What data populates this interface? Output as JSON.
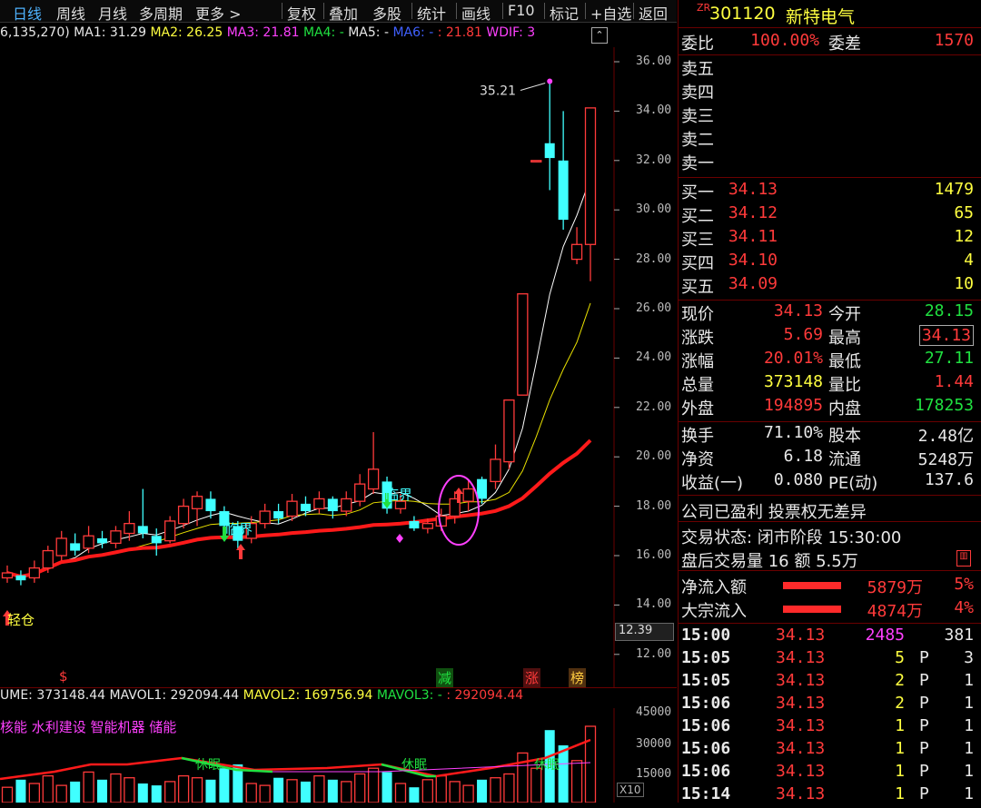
{
  "toolbar": {
    "items": [
      "日线",
      "周线",
      "月线",
      "多周期",
      "更多 >",
      "复权",
      "叠加",
      "多股",
      "统计",
      "画线",
      "F10",
      "标记",
      "+自选",
      "返回"
    ],
    "selected": "日线"
  },
  "ma_line": {
    "prefix": "6,135,270)",
    "ma1": "MA1: 31.29",
    "ma2": "MA2: 26.25",
    "ma3": "MA3: 21.81",
    "ma4": "MA4: -",
    "ma5": "MA5: -",
    "ma6": "MA6: -",
    "ma_last": ": 21.81",
    "wdif": "WDIF: 3"
  },
  "chart_data": {
    "type": "candlestick",
    "y_ticks": [
      "36.00",
      "34.00",
      "32.00",
      "30.00",
      "28.00",
      "26.00",
      "24.00",
      "22.00",
      "20.00",
      "18.00",
      "16.00",
      "14.00",
      "12.00"
    ],
    "ylim": [
      12,
      36.5
    ],
    "current_price_label": "12.39",
    "high_annotation": "35.21",
    "candles": [
      {
        "o": 15.1,
        "c": 15.3,
        "h": 15.6,
        "l": 14.9
      },
      {
        "o": 15.2,
        "c": 15.0,
        "h": 15.4,
        "l": 14.8
      },
      {
        "o": 15.1,
        "c": 15.5,
        "h": 15.8,
        "l": 14.9
      },
      {
        "o": 15.5,
        "c": 16.2,
        "h": 16.4,
        "l": 15.3
      },
      {
        "o": 16.0,
        "c": 16.7,
        "h": 17.0,
        "l": 15.8
      },
      {
        "o": 16.5,
        "c": 16.2,
        "h": 16.9,
        "l": 16.0
      },
      {
        "o": 16.3,
        "c": 16.8,
        "h": 17.2,
        "l": 16.1
      },
      {
        "o": 16.7,
        "c": 16.5,
        "h": 17.0,
        "l": 16.3
      },
      {
        "o": 16.5,
        "c": 17.0,
        "h": 17.2,
        "l": 16.3
      },
      {
        "o": 16.9,
        "c": 17.3,
        "h": 17.8,
        "l": 16.6
      },
      {
        "o": 17.2,
        "c": 16.9,
        "h": 18.7,
        "l": 16.7
      },
      {
        "o": 16.8,
        "c": 16.5,
        "h": 17.1,
        "l": 16.0
      },
      {
        "o": 16.6,
        "c": 17.4,
        "h": 17.6,
        "l": 16.5
      },
      {
        "o": 17.3,
        "c": 18.0,
        "h": 18.3,
        "l": 17.1
      },
      {
        "o": 17.9,
        "c": 18.4,
        "h": 18.6,
        "l": 17.2
      },
      {
        "o": 18.3,
        "c": 17.8,
        "h": 18.6,
        "l": 17.5
      },
      {
        "o": 17.8,
        "c": 17.2,
        "h": 18.0,
        "l": 17.0
      },
      {
        "o": 17.2,
        "c": 16.6,
        "h": 17.4,
        "l": 16.3
      },
      {
        "o": 16.7,
        "c": 17.3,
        "h": 17.6,
        "l": 16.5
      },
      {
        "o": 17.3,
        "c": 17.8,
        "h": 18.1,
        "l": 17.1
      },
      {
        "o": 17.8,
        "c": 17.5,
        "h": 18.1,
        "l": 17.3
      },
      {
        "o": 17.6,
        "c": 18.2,
        "h": 18.5,
        "l": 17.4
      },
      {
        "o": 18.1,
        "c": 17.8,
        "h": 18.4,
        "l": 17.6
      },
      {
        "o": 17.9,
        "c": 18.3,
        "h": 18.6,
        "l": 17.7
      },
      {
        "o": 18.3,
        "c": 17.8,
        "h": 18.4,
        "l": 17.5
      },
      {
        "o": 17.8,
        "c": 18.3,
        "h": 18.6,
        "l": 17.6
      },
      {
        "o": 18.2,
        "c": 18.9,
        "h": 19.3,
        "l": 18.0
      },
      {
        "o": 18.7,
        "c": 19.5,
        "h": 21.0,
        "l": 18.5
      },
      {
        "o": 19.0,
        "c": 17.9,
        "h": 19.2,
        "l": 17.7
      },
      {
        "o": 17.9,
        "c": 18.2,
        "h": 18.5,
        "l": 17.7
      },
      {
        "o": 17.4,
        "c": 17.1,
        "h": 17.6,
        "l": 17.0
      },
      {
        "o": 17.1,
        "c": 17.3,
        "h": 17.5,
        "l": 16.9
      },
      {
        "o": 17.2,
        "c": 17.6,
        "h": 17.9,
        "l": 17.0
      },
      {
        "o": 17.6,
        "c": 18.3,
        "h": 18.6,
        "l": 17.3
      },
      {
        "o": 18.2,
        "c": 18.7,
        "h": 19.1,
        "l": 17.8
      },
      {
        "o": 19.1,
        "c": 18.3,
        "h": 19.2,
        "l": 18.1
      },
      {
        "o": 19.0,
        "c": 19.9,
        "h": 20.5,
        "l": 18.7
      },
      {
        "o": 19.8,
        "c": 22.3,
        "h": 22.3,
        "l": 19.5
      },
      {
        "o": 22.5,
        "c": 26.6,
        "h": 26.6,
        "l": 22.5
      },
      {
        "o": 32.0,
        "c": 32.0,
        "h": 32.0,
        "l": 32.0
      },
      {
        "o": 32.7,
        "c": 32.1,
        "h": 35.21,
        "l": 30.8
      },
      {
        "o": 32.0,
        "c": 29.6,
        "h": 34.0,
        "l": 29.2
      },
      {
        "o": 28.0,
        "c": 28.6,
        "h": 29.3,
        "l": 27.8
      },
      {
        "o": 28.6,
        "c": 34.13,
        "h": 34.13,
        "l": 27.11
      }
    ],
    "signals": [
      {
        "label": "轻仓",
        "color": "#ffff40"
      },
      {
        "label": "临界",
        "color": "#40ffff"
      },
      {
        "label": "临界",
        "color": "#40ffff"
      }
    ],
    "bottom_markers": [
      {
        "label": "$",
        "color": "#ff3a3a"
      },
      {
        "label": "减",
        "color": "#20e040",
        "bg": "#105010"
      },
      {
        "label": "涨",
        "color": "#ff3a3a",
        "bg": "#501010"
      },
      {
        "label": "榜",
        "color": "#ffcc40",
        "bg": "#503010"
      }
    ]
  },
  "volume": {
    "line": {
      "volume": "UME: 373148.44",
      "mavol1": "MAVOL1: 292094.44",
      "mavol2": "MAVOL2: 169756.94",
      "mavol3": "MAVOL3: -",
      "mavol_last": ": 292094.44"
    },
    "concepts": "核能 水利建设 智能机器 储能",
    "y_ticks": [
      "45000",
      "30000",
      "15000"
    ],
    "x_label": "X10",
    "sleep_labels": [
      "休眠",
      "休眠",
      "休眠"
    ],
    "bars": [
      8,
      12,
      10,
      14,
      9,
      11,
      16,
      12,
      15,
      13,
      10,
      9,
      11,
      14,
      13,
      12,
      18,
      20,
      10,
      9,
      13,
      12,
      11,
      14,
      12,
      11,
      15,
      18,
      16,
      10,
      8,
      12,
      14,
      11,
      9,
      12,
      13,
      15,
      26,
      18,
      38,
      30,
      22,
      40
    ]
  },
  "quote": {
    "code": "301120",
    "name": "新特电气",
    "badge": "ZR",
    "weibi_label": "委比",
    "weibi": "100.00%",
    "weicha_label": "委差",
    "weicha": "1570",
    "sell": [
      {
        "label": "卖五"
      },
      {
        "label": "卖四"
      },
      {
        "label": "卖三"
      },
      {
        "label": "卖二"
      },
      {
        "label": "卖一"
      }
    ],
    "buy": [
      {
        "label": "买一",
        "price": "34.13",
        "vol": "1479"
      },
      {
        "label": "买二",
        "price": "34.12",
        "vol": "65"
      },
      {
        "label": "买三",
        "price": "34.11",
        "vol": "12"
      },
      {
        "label": "买四",
        "price": "34.10",
        "vol": "4"
      },
      {
        "label": "买五",
        "price": "34.09",
        "vol": "10"
      }
    ],
    "stats": [
      {
        "l": "现价",
        "lv": "34.13",
        "lc": "red",
        "r": "今开",
        "rv": "28.15",
        "rc": "green"
      },
      {
        "l": "涨跌",
        "lv": "5.69",
        "lc": "red",
        "r": "最高",
        "rv": "34.13",
        "rc": "red"
      },
      {
        "l": "涨幅",
        "lv": "20.01%",
        "lc": "red",
        "r": "最低",
        "rv": "27.11",
        "rc": "green"
      },
      {
        "l": "总量",
        "lv": "373148",
        "lc": "yellow",
        "r": "量比",
        "rv": "1.44",
        "rc": "red"
      },
      {
        "l": "外盘",
        "lv": "194895",
        "lc": "red",
        "r": "内盘",
        "rv": "178253",
        "rc": "green"
      }
    ],
    "stats2": [
      {
        "l": "换手",
        "lv": "71.10%",
        "r": "股本",
        "rv": "2.48亿"
      },
      {
        "l": "净资",
        "lv": "6.18",
        "r": "流通",
        "rv": "5248万"
      },
      {
        "l": "收益(一)",
        "lv": "0.080",
        "r": "PE(动)",
        "rv": "137.6"
      }
    ],
    "profit_note": "公司已盈利 投票权无差异",
    "trade_status": "交易状态: 闭市阶段 15:30:00",
    "after_hours": "盘后交易量 16 额 5.5万",
    "flows": [
      {
        "label": "净流入额",
        "value": "5879万",
        "pct": "5%",
        "bar": 0.55
      },
      {
        "label": "大宗流入",
        "value": "4874万",
        "pct": "4%",
        "bar": 0.55
      }
    ],
    "ticks": [
      {
        "t": "15:00",
        "p": "34.13",
        "v": "2485",
        "f": "",
        "n": "381",
        "vc": "magenta"
      },
      {
        "t": "15:05",
        "p": "34.13",
        "v": "5",
        "f": "P",
        "n": "3",
        "vc": "yellow"
      },
      {
        "t": "15:05",
        "p": "34.13",
        "v": "2",
        "f": "P",
        "n": "1",
        "vc": "yellow"
      },
      {
        "t": "15:06",
        "p": "34.13",
        "v": "2",
        "f": "P",
        "n": "1",
        "vc": "yellow"
      },
      {
        "t": "15:06",
        "p": "34.13",
        "v": "1",
        "f": "P",
        "n": "1",
        "vc": "yellow"
      },
      {
        "t": "15:06",
        "p": "34.13",
        "v": "1",
        "f": "P",
        "n": "1",
        "vc": "yellow"
      },
      {
        "t": "15:06",
        "p": "34.13",
        "v": "1",
        "f": "P",
        "n": "1",
        "vc": "yellow"
      },
      {
        "t": "15:14",
        "p": "34.13",
        "v": "1",
        "f": "P",
        "n": "1",
        "vc": "yellow"
      }
    ]
  }
}
